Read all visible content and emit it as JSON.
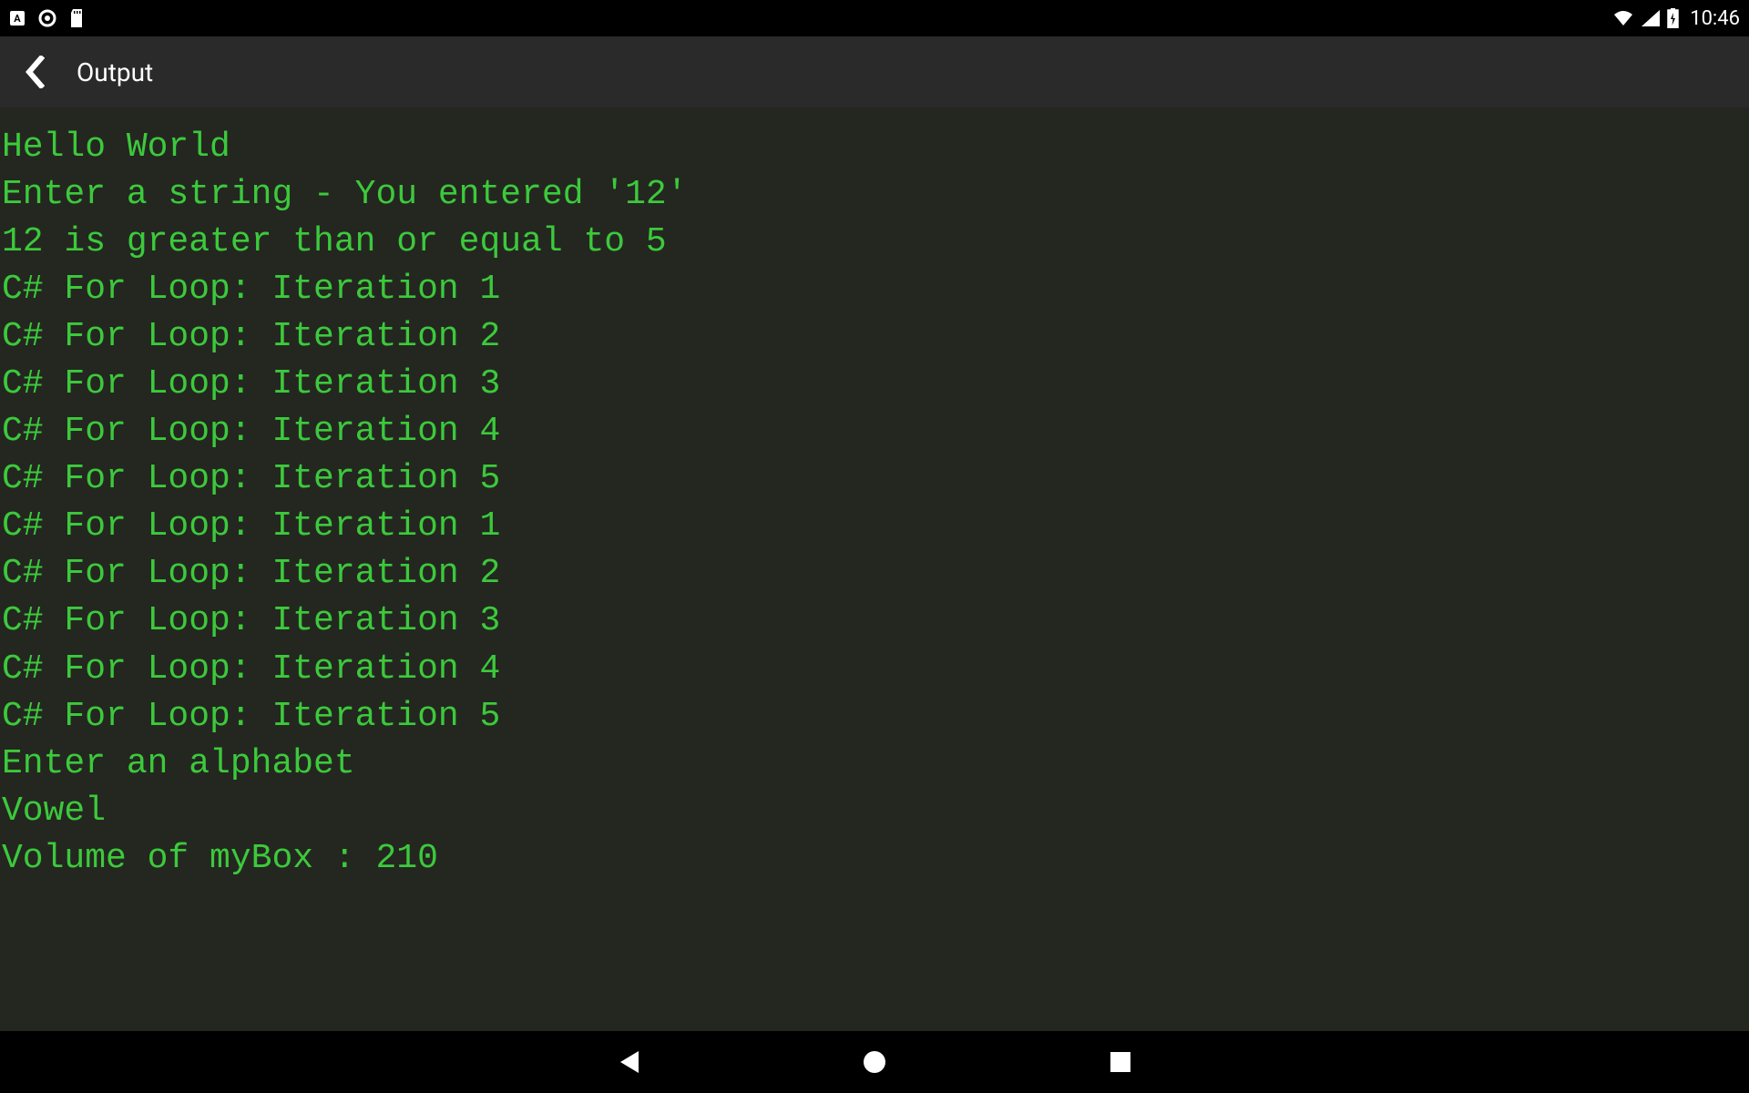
{
  "status_bar": {
    "clock": "10:46"
  },
  "app_bar": {
    "title": "Output"
  },
  "output": {
    "lines": [
      "Hello World",
      "Enter a string - You entered '12'",
      "12 is greater than or equal to 5",
      "C# For Loop: Iteration 1",
      "C# For Loop: Iteration 2",
      "C# For Loop: Iteration 3",
      "C# For Loop: Iteration 4",
      "C# For Loop: Iteration 5",
      "C# For Loop: Iteration 1",
      "C# For Loop: Iteration 2",
      "C# For Loop: Iteration 3",
      "C# For Loop: Iteration 4",
      "C# For Loop: Iteration 5",
      "Enter an alphabet",
      "Vowel",
      "Volume of myBox : 210"
    ]
  }
}
